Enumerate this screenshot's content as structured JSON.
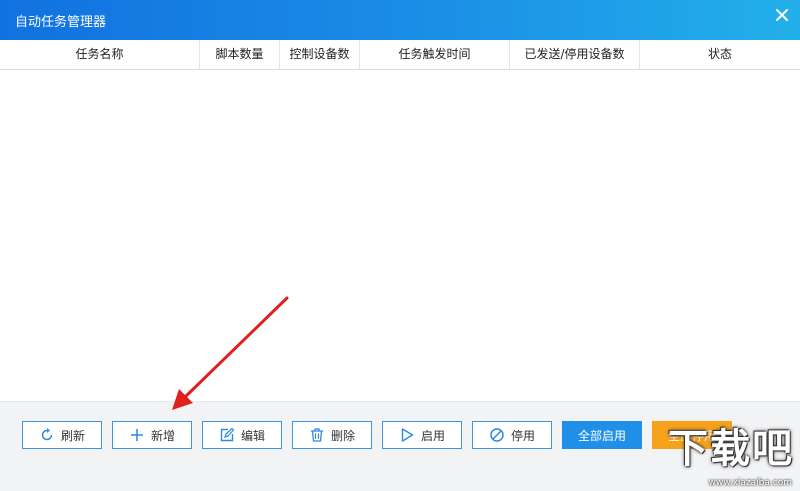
{
  "window": {
    "title": "自动任务管理器",
    "close_icon": "close-icon",
    "titlebar_colors": [
      "#1171e0",
      "#22b0ea"
    ]
  },
  "table": {
    "columns": [
      {
        "label": "任务名称"
      },
      {
        "label": "脚本数量"
      },
      {
        "label": "控制设备数"
      },
      {
        "label": "任务触发时间"
      },
      {
        "label": "已发送/停用设备数"
      },
      {
        "label": "状态"
      }
    ],
    "rows": []
  },
  "toolbar": {
    "buttons": [
      {
        "label": "刷新",
        "icon": "refresh-icon"
      },
      {
        "label": "新增",
        "icon": "plus-icon"
      },
      {
        "label": "编辑",
        "icon": "edit-icon"
      },
      {
        "label": "删除",
        "icon": "trash-icon"
      },
      {
        "label": "启用",
        "icon": "play-icon"
      },
      {
        "label": "停用",
        "icon": "stop-icon"
      },
      {
        "label": "全部启用",
        "style": "primary",
        "color": "#1f8fe8"
      },
      {
        "label": "全部停用",
        "style": "warning",
        "color": "#f7a21b"
      }
    ]
  },
  "watermark": {
    "text": "下载吧",
    "url": "www.xiazaiba.com"
  },
  "annotation": {
    "type": "red-arrow",
    "color": "#e0201c"
  }
}
